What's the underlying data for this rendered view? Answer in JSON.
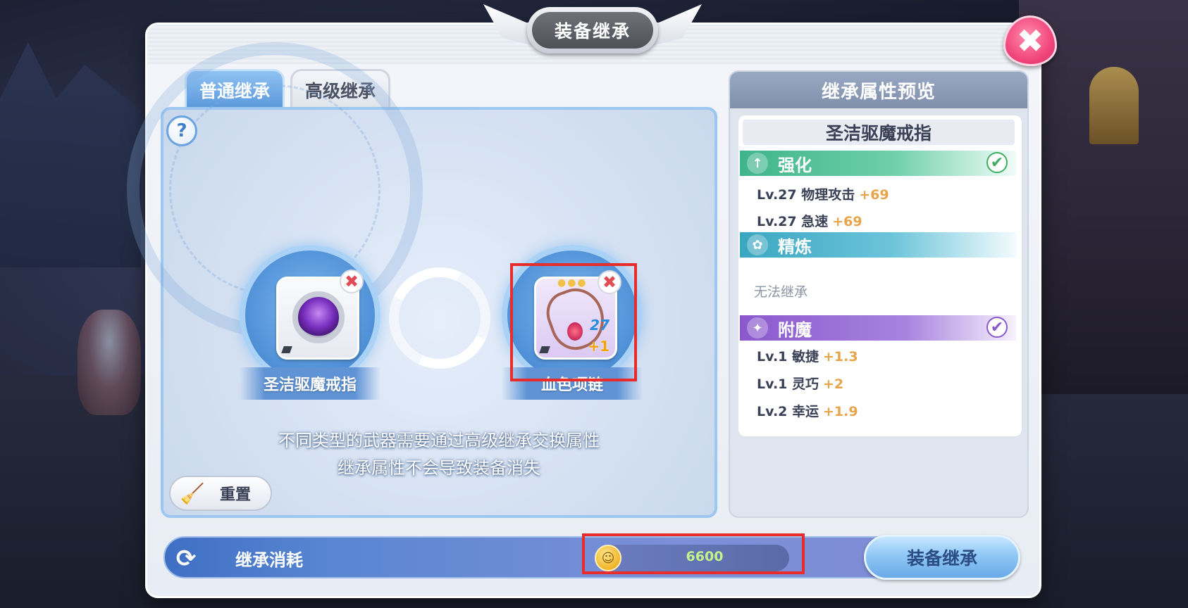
{
  "window": {
    "title": "装备继承",
    "close_icon": "✖"
  },
  "tabs": [
    {
      "label": "普通继承",
      "active": true
    },
    {
      "label": "高级继承",
      "active": false
    }
  ],
  "help": {
    "icon": "?"
  },
  "source_item": {
    "name": "圣洁驱魔戒指",
    "icon": "purple-ring-icon",
    "remove_icon": "✖"
  },
  "target_item": {
    "name": "血色项链",
    "icon": "necklace-icon",
    "stars": "●●●",
    "level": "27",
    "refine": "+1",
    "remove_icon": "✖"
  },
  "hints": {
    "line1": "不同类型的武器需要通过高级继承交换属性",
    "line2": "继承属性不会导致装备消失"
  },
  "reset": {
    "label": "重置",
    "icon": "broom-icon"
  },
  "preview": {
    "header": "继承属性预览",
    "item_name": "圣洁驱魔戒指",
    "sections": {
      "strength": {
        "label": "强化",
        "icon": "↑",
        "checked": true,
        "attrs": [
          {
            "name": "Lv.27 物理攻击",
            "value": "+69"
          },
          {
            "name": "Lv.27 急速",
            "value": "+69"
          }
        ]
      },
      "refine": {
        "label": "精炼",
        "icon": "✿",
        "note": "无法继承"
      },
      "enchant": {
        "label": "附魔",
        "icon": "✦",
        "checked": true,
        "attrs": [
          {
            "name": "Lv.1 敏捷",
            "value": "+1.3"
          },
          {
            "name": "Lv.1 灵巧",
            "value": "+2"
          },
          {
            "name": "Lv.2 幸运",
            "value": "+1.9"
          }
        ]
      }
    },
    "check_glyph": "✔"
  },
  "cost": {
    "icon": "⟳",
    "label": "继承消耗",
    "coin_icon": "☺",
    "amount": "6600"
  },
  "action": {
    "label": "装备继承"
  },
  "colors": {
    "accent_blue": "#5b98dc",
    "close_pink": "#f2477c",
    "strength_green": "#3fb48c",
    "refine_teal": "#3aa6c0",
    "enchant_purple": "#8a58cc",
    "value_orange": "#e8a44a",
    "highlight_red": "#e82c2c"
  }
}
